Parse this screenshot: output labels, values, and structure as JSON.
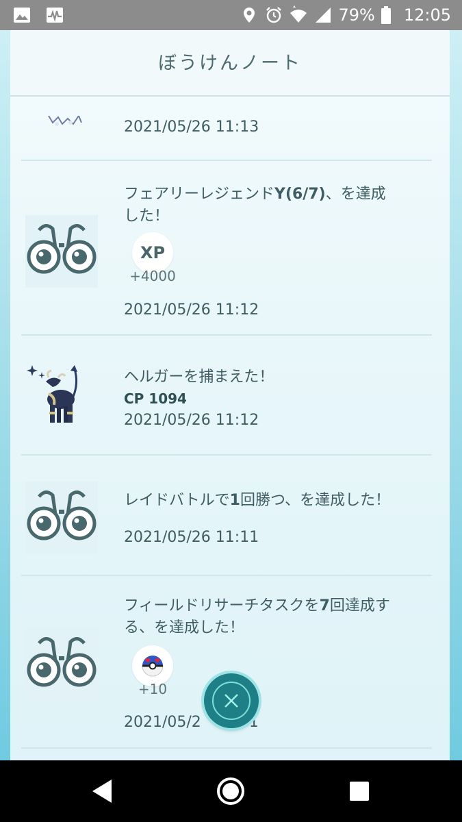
{
  "status_bar": {
    "battery_percent": "79%",
    "time": "12:05",
    "icons": [
      "image-icon",
      "activity-icon",
      "location-icon",
      "alarm-icon",
      "wifi-icon",
      "signal-icon",
      "battery-icon"
    ]
  },
  "journal": {
    "title": "ぼうけんノート",
    "partial_timestamp": "2021/05/26 11:13",
    "entries": [
      {
        "type": "research",
        "icon": "binoculars-icon",
        "text_parts": [
          "フェアリーレジェンド",
          "Y(6/7)",
          "、を達成"
        ],
        "text_line2": "した！",
        "reward_label": "XP",
        "reward_qty": "+4000",
        "timestamp": "2021/05/26 11:12"
      },
      {
        "type": "catch",
        "icon": "houndoom-sprite-icon",
        "text": "ヘルガーを捕まえた！",
        "cp": "CP 1094",
        "timestamp": "2021/05/26 11:12"
      },
      {
        "type": "research",
        "icon": "binoculars-icon",
        "text_parts": [
          "レイドバトルで",
          "1",
          "回勝つ、を達成した！"
        ],
        "timestamp": "2021/05/26 11:11"
      },
      {
        "type": "research",
        "icon": "binoculars-icon",
        "text_parts": [
          "フィールドリサーチタスクを",
          "7",
          "回達成す"
        ],
        "text_line2": "る、を達成した！",
        "reward_icon": "great-ball-icon",
        "reward_qty": "+10",
        "timestamp_visible": "2021/05/2",
        "timestamp_tail": "1"
      }
    ]
  },
  "colors": {
    "accent": "#1e7f86",
    "text": "#3f5d62",
    "panel": "#f2f9fa",
    "status_bar": "#8c8c8c"
  }
}
